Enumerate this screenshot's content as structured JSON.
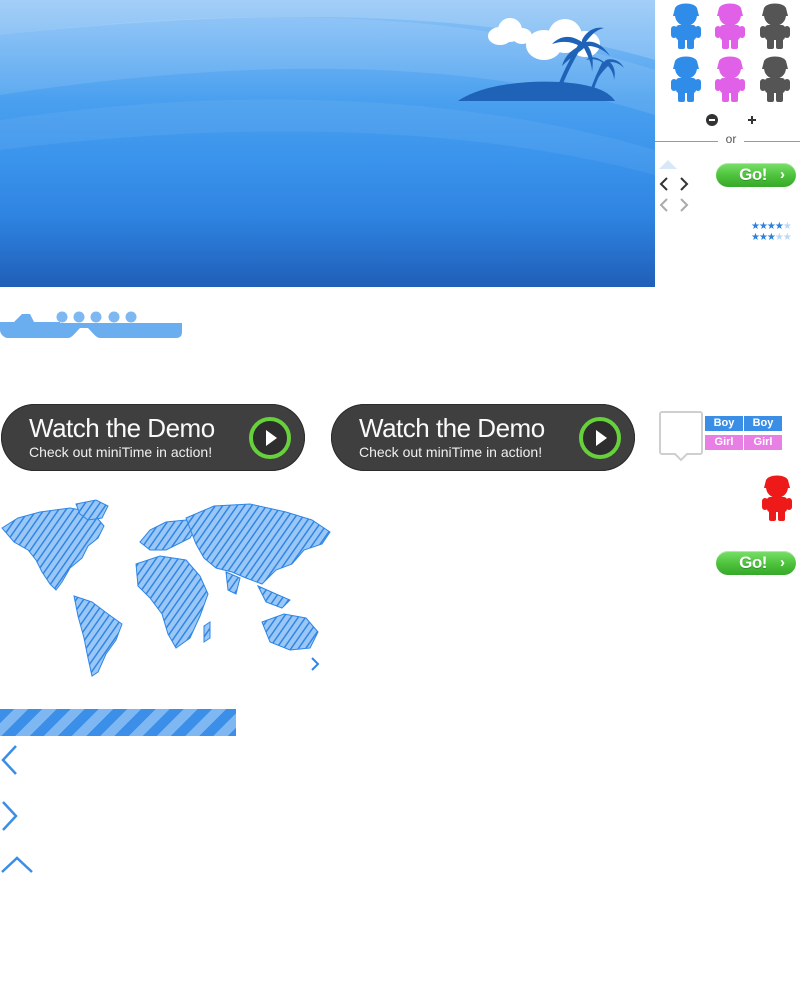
{
  "panel": {
    "divider_text": "or",
    "go_label": "Go!",
    "go_chevron": "›",
    "ratings": [
      {
        "filled": 4,
        "total": 5
      },
      {
        "filled": 3,
        "total": 5
      }
    ],
    "figures": [
      {
        "name": "boy-figure-icon",
        "color": "#2f8ce8"
      },
      {
        "name": "girl-figure-icon",
        "color": "#e060e8"
      },
      {
        "name": "grey-figure-icon",
        "color": "#555555"
      },
      {
        "name": "boy-figure-icon",
        "color": "#2f8ce8"
      },
      {
        "name": "girl-figure-icon",
        "color": "#e060e8"
      },
      {
        "name": "grey-figure-icon",
        "color": "#555555"
      }
    ],
    "highlight_figure_color": "#ee1a1a"
  },
  "demo": {
    "title": "Watch the Demo",
    "subtitle": "Check out miniTime in action!"
  },
  "gender_tags": {
    "boy": "Boy",
    "girl": "Girl"
  },
  "colors": {
    "accent_blue": "#3b8fe8",
    "go_green": "#4cc13a",
    "demo_dark": "#3f3f3f"
  }
}
